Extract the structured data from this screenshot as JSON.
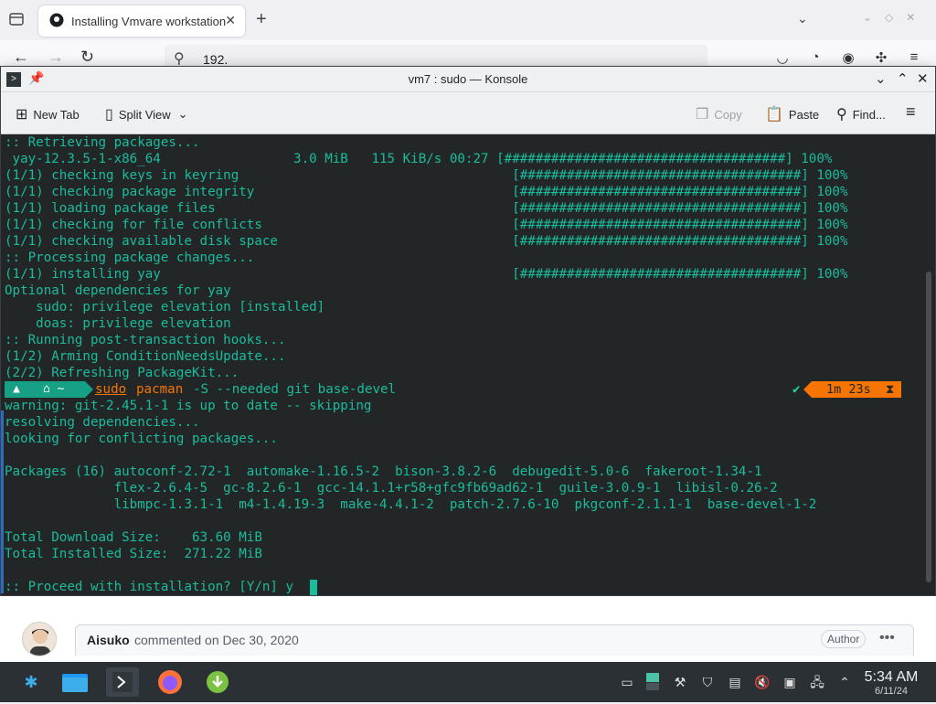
{
  "browser": {
    "tab_title": "Installing Vmvare workstation",
    "url": "192.",
    "icons": {
      "list_all_tabs": "tabs-list-icon",
      "new_tab": "plus-icon",
      "back": "back-arrow-icon",
      "forward": "forward-arrow-icon",
      "reload": "reload-icon",
      "search": "search-icon",
      "pocket": "pocket-icon",
      "sync": "sync-icon",
      "account": "account-icon",
      "extensions": "extensions-icon",
      "menu": "hamburger-menu-icon"
    }
  },
  "konsole": {
    "title": "vm7 : sudo — Konsole",
    "toolbar": {
      "new_tab": "New Tab",
      "split_view": "Split View",
      "copy": "Copy",
      "paste": "Paste",
      "find": "Find..."
    },
    "terminal_lines": [
      ":: Retrieving packages...",
      " yay-12.3.5-1-x86_64                 3.0 MiB   115 KiB/s 00:27 [####################################] 100%",
      "(1/1) checking keys in keyring                                   [####################################] 100%",
      "(1/1) checking package integrity                                 [####################################] 100%",
      "(1/1) loading package files                                      [####################################] 100%",
      "(1/1) checking for file conflicts                                [####################################] 100%",
      "(1/1) checking available disk space                              [####################################] 100%",
      ":: Processing package changes...",
      "(1/1) installing yay                                             [####################################] 100%",
      "Optional dependencies for yay",
      "    sudo: privilege elevation [installed]",
      "    doas: privilege elevation",
      ":: Running post-transaction hooks...",
      "(1/2) Arming ConditionNeedsUpdate...",
      "(2/2) Refreshing PackageKit..."
    ],
    "prompt": {
      "os_segment": "",
      "dir_segment": "~",
      "cmd_sudo": "sudo",
      "cmd_pacman": "pacman",
      "cmd_rest": "-S --needed git base-devel",
      "status_check": "✔",
      "duration": "1m 23s",
      "hourglass": "⧗"
    },
    "output_lines": [
      "warning: git-2.45.1-1 is up to date -- skipping",
      "resolving dependencies...",
      "looking for conflicting packages...",
      "",
      "Packages (16) autoconf-2.72-1  automake-1.16.5-2  bison-3.8.2-6  debugedit-5.0-6  fakeroot-1.34-1",
      "              flex-2.6.4-5  gc-8.2.6-1  gcc-14.1.1+r58+gfc9fb69ad62-1  guile-3.0.9-1  libisl-0.26-2",
      "              libmpc-1.3.1-1  m4-1.4.19-3  make-4.4.1-2  patch-2.7.6-10  pkgconf-2.1.1-1  base-devel-1-2",
      "",
      "Total Download Size:    63.60 MiB",
      "Total Installed Size:  271.22 MiB",
      "",
      ":: Proceed with installation? [Y/n] y"
    ]
  },
  "page": {
    "comment_author": "Aisuko",
    "comment_meta": "commented on Dec 30, 2020",
    "author_badge": "Author"
  },
  "taskbar": {
    "time": "5:34 AM",
    "date": "6/11/24"
  },
  "colors": {
    "terminal_bg": "#232627",
    "terminal_fg": "#1abc9c",
    "prompt_accent": "#f67400",
    "prompt_teal": "#16a085"
  }
}
